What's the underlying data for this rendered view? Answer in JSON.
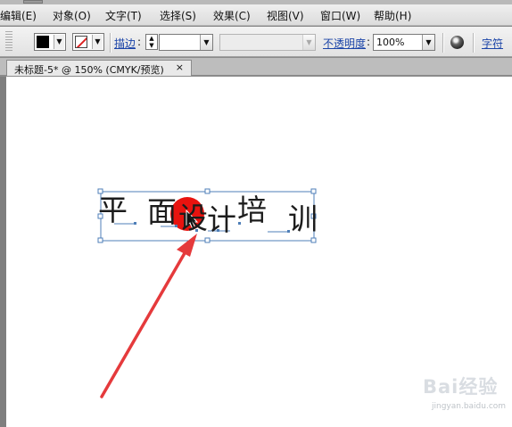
{
  "menu": [
    "编辑(E)",
    "对象(O)",
    "文字(T)",
    "选择(S)",
    "效果(C)",
    "视图(V)",
    "窗口(W)",
    "帮助(H)"
  ],
  "toolbar": {
    "stroke_label": "描边",
    "stroke_colon": ":",
    "opacity_label": "不透明度",
    "opacity_colon": ":",
    "opacity_value": "100%",
    "char_label": "字符"
  },
  "document_tab": {
    "title": "未标题-5* @ 150% (CMYK/预览)",
    "close": "×"
  },
  "artwork": {
    "chars": [
      "平",
      "面",
      "设",
      "计",
      "培",
      "训"
    ],
    "circle_color": "#e8130f",
    "selection_color": "#4f7fb8"
  },
  "annotation": {
    "arrow_color": "#e53a3c"
  },
  "watermark": {
    "brand": "Bai经验",
    "url": "jingyan.baidu.com"
  }
}
